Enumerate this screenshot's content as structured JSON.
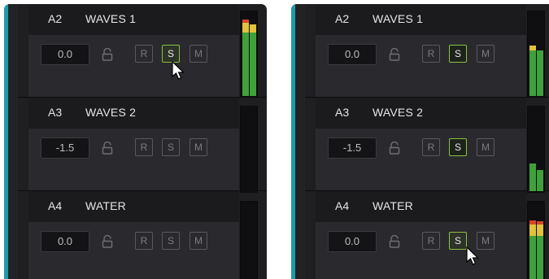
{
  "panels": [
    {
      "tracks": [
        {
          "id": "A2",
          "name": "WAVES 1",
          "volume": "0.0",
          "buttons": {
            "r": "R",
            "s": "S",
            "m": "M"
          }
        },
        {
          "id": "A3",
          "name": "WAVES 2",
          "volume": "-1.5",
          "buttons": {
            "r": "R",
            "s": "S",
            "m": "M"
          }
        },
        {
          "id": "A4",
          "name": "WATER",
          "volume": "0.0",
          "buttons": {
            "r": "R",
            "s": "S",
            "m": "M"
          }
        }
      ]
    },
    {
      "tracks": [
        {
          "id": "A2",
          "name": "WAVES 1",
          "volume": "0.0",
          "buttons": {
            "r": "R",
            "s": "S",
            "m": "M"
          }
        },
        {
          "id": "A3",
          "name": "WAVES 2",
          "volume": "-1.5",
          "buttons": {
            "r": "R",
            "s": "S",
            "m": "M"
          }
        },
        {
          "id": "A4",
          "name": "WATER",
          "volume": "0.0",
          "buttons": {
            "r": "R",
            "s": "S",
            "m": "M"
          }
        }
      ]
    }
  ],
  "colors": {
    "accent": "#1e9ba7",
    "solo_active": "#8cbf3f",
    "meter_green": "#3fa13a",
    "meter_yellow": "#e1c23a",
    "meter_red": "#d8452c"
  }
}
